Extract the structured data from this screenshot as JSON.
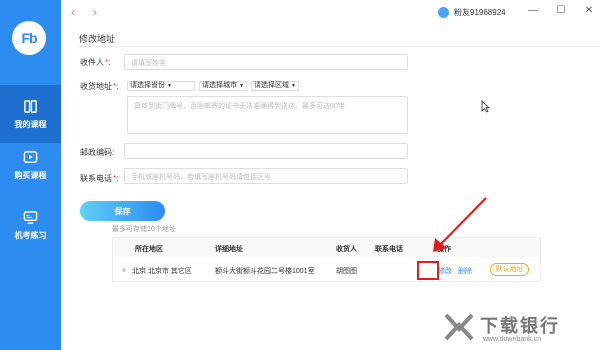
{
  "sidebar": {
    "logo_text": "Fb",
    "items": [
      {
        "label": "我的课程",
        "icon": "book-icon",
        "active": true
      },
      {
        "label": "购买课程",
        "icon": "play-icon",
        "active": false
      },
      {
        "label": "机考练习",
        "icon": "monitor-icon",
        "active": false
      }
    ]
  },
  "topbar": {
    "back": "‹",
    "forward": "›",
    "username": "粉友91968924",
    "minimize": "—",
    "maximize": "☐",
    "close": "✕"
  },
  "page": {
    "title": "修改地址"
  },
  "form": {
    "recipient": {
      "label": "收件人",
      "placeholder": "请填写姓名"
    },
    "address": {
      "label": "收货地址",
      "province": "请选择省份",
      "city": "请选择城市",
      "district": "请选择区域",
      "detail_placeholder": "具体到街门牌号，否则邮寄的证书无法准确得到送达。最多可达60字"
    },
    "postcode": {
      "label": "邮政编码",
      "placeholder": ""
    },
    "phone": {
      "label": "联系电话",
      "placeholder": "手机或座机号码，若填写座机号码请包括区号"
    },
    "required_mark": "*",
    "colon": ":"
  },
  "save_button": "保存",
  "hint": "最多可存储10个地址",
  "table": {
    "headers": [
      "所在地区",
      "详细地址",
      "收货人",
      "联系电话",
      "操作"
    ],
    "rows": [
      {
        "region": "北京 北京市 其它区",
        "detail": "额斗大街额斗花园二号楼1001室",
        "recipient": "胡图图",
        "phone": "",
        "edit": "修改",
        "delete": "删除",
        "default": "默认地址"
      }
    ]
  },
  "watermark": {
    "main": "下载银行",
    "sub": "www.downbank.cn"
  },
  "colors": {
    "accent": "#2d8cf0",
    "sidebar_active": "#1f6fd1",
    "annotation": "#e02020",
    "default_tag": "#f5a623"
  }
}
